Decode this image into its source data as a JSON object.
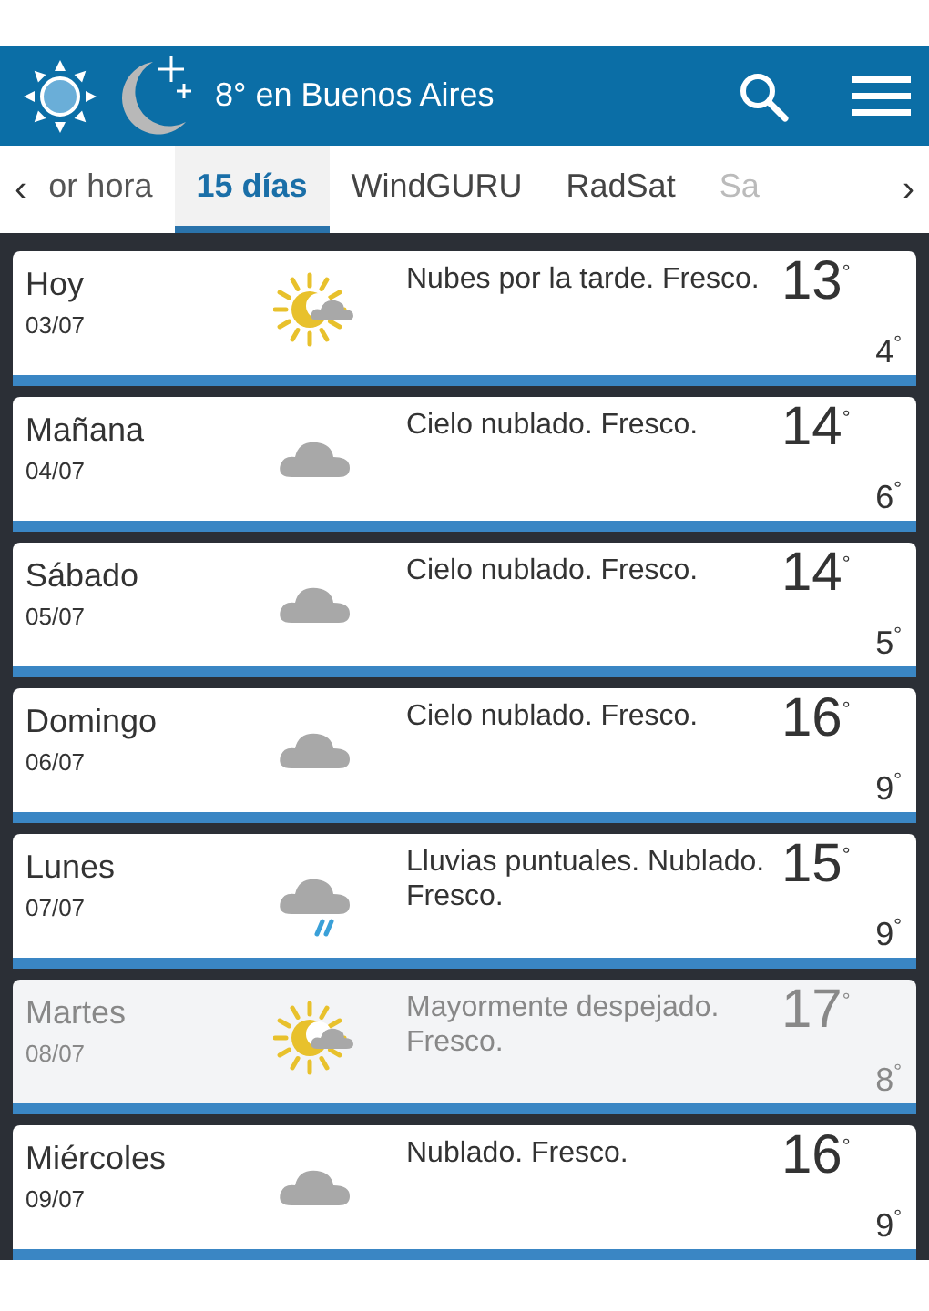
{
  "header": {
    "title": "8° en Buenos Aires"
  },
  "tabs": [
    {
      "label": "or hora",
      "selected": false
    },
    {
      "label": "15 días",
      "selected": true
    },
    {
      "label": "WindGURU",
      "selected": false
    },
    {
      "label": "RadSat",
      "selected": false
    },
    {
      "label": "Sa",
      "selected": false
    }
  ],
  "tab_arrows": {
    "left": "‹",
    "right": "›"
  },
  "days": [
    {
      "day": "Hoy",
      "date": "03/07",
      "kind": "sun-cloud",
      "summary": "Nubes por la tarde. Fresco.",
      "max": "13",
      "min": "4",
      "degree": "°",
      "highlighted": false
    },
    {
      "day": "Mañana",
      "date": "04/07",
      "kind": "cloud",
      "summary": "Cielo nublado. Fresco.",
      "max": "14",
      "min": "6",
      "degree": "°",
      "highlighted": false
    },
    {
      "day": "Sábado",
      "date": "05/07",
      "kind": "cloud",
      "summary": "Cielo nublado. Fresco.",
      "max": "14",
      "min": "5",
      "degree": "°",
      "highlighted": false
    },
    {
      "day": "Domingo",
      "date": "06/07",
      "kind": "cloud",
      "summary": "Cielo nublado. Fresco.",
      "max": "16",
      "min": "9",
      "degree": "°",
      "highlighted": false
    },
    {
      "day": "Lunes",
      "date": "07/07",
      "kind": "rain",
      "summary": "Lluvias puntuales. Nublado. Fresco.",
      "max": "15",
      "min": "9",
      "degree": "°",
      "highlighted": false
    },
    {
      "day": "Martes",
      "date": "08/07",
      "kind": "sun-cloud",
      "summary": "Mayormente despejado. Fresco.",
      "max": "17",
      "min": "8",
      "degree": "°",
      "highlighted": true
    },
    {
      "day": "Miércoles",
      "date": "09/07",
      "kind": "cloud",
      "summary": "Nublado. Fresco.",
      "max": "16",
      "min": "9",
      "degree": "°",
      "highlighted": false
    }
  ]
}
